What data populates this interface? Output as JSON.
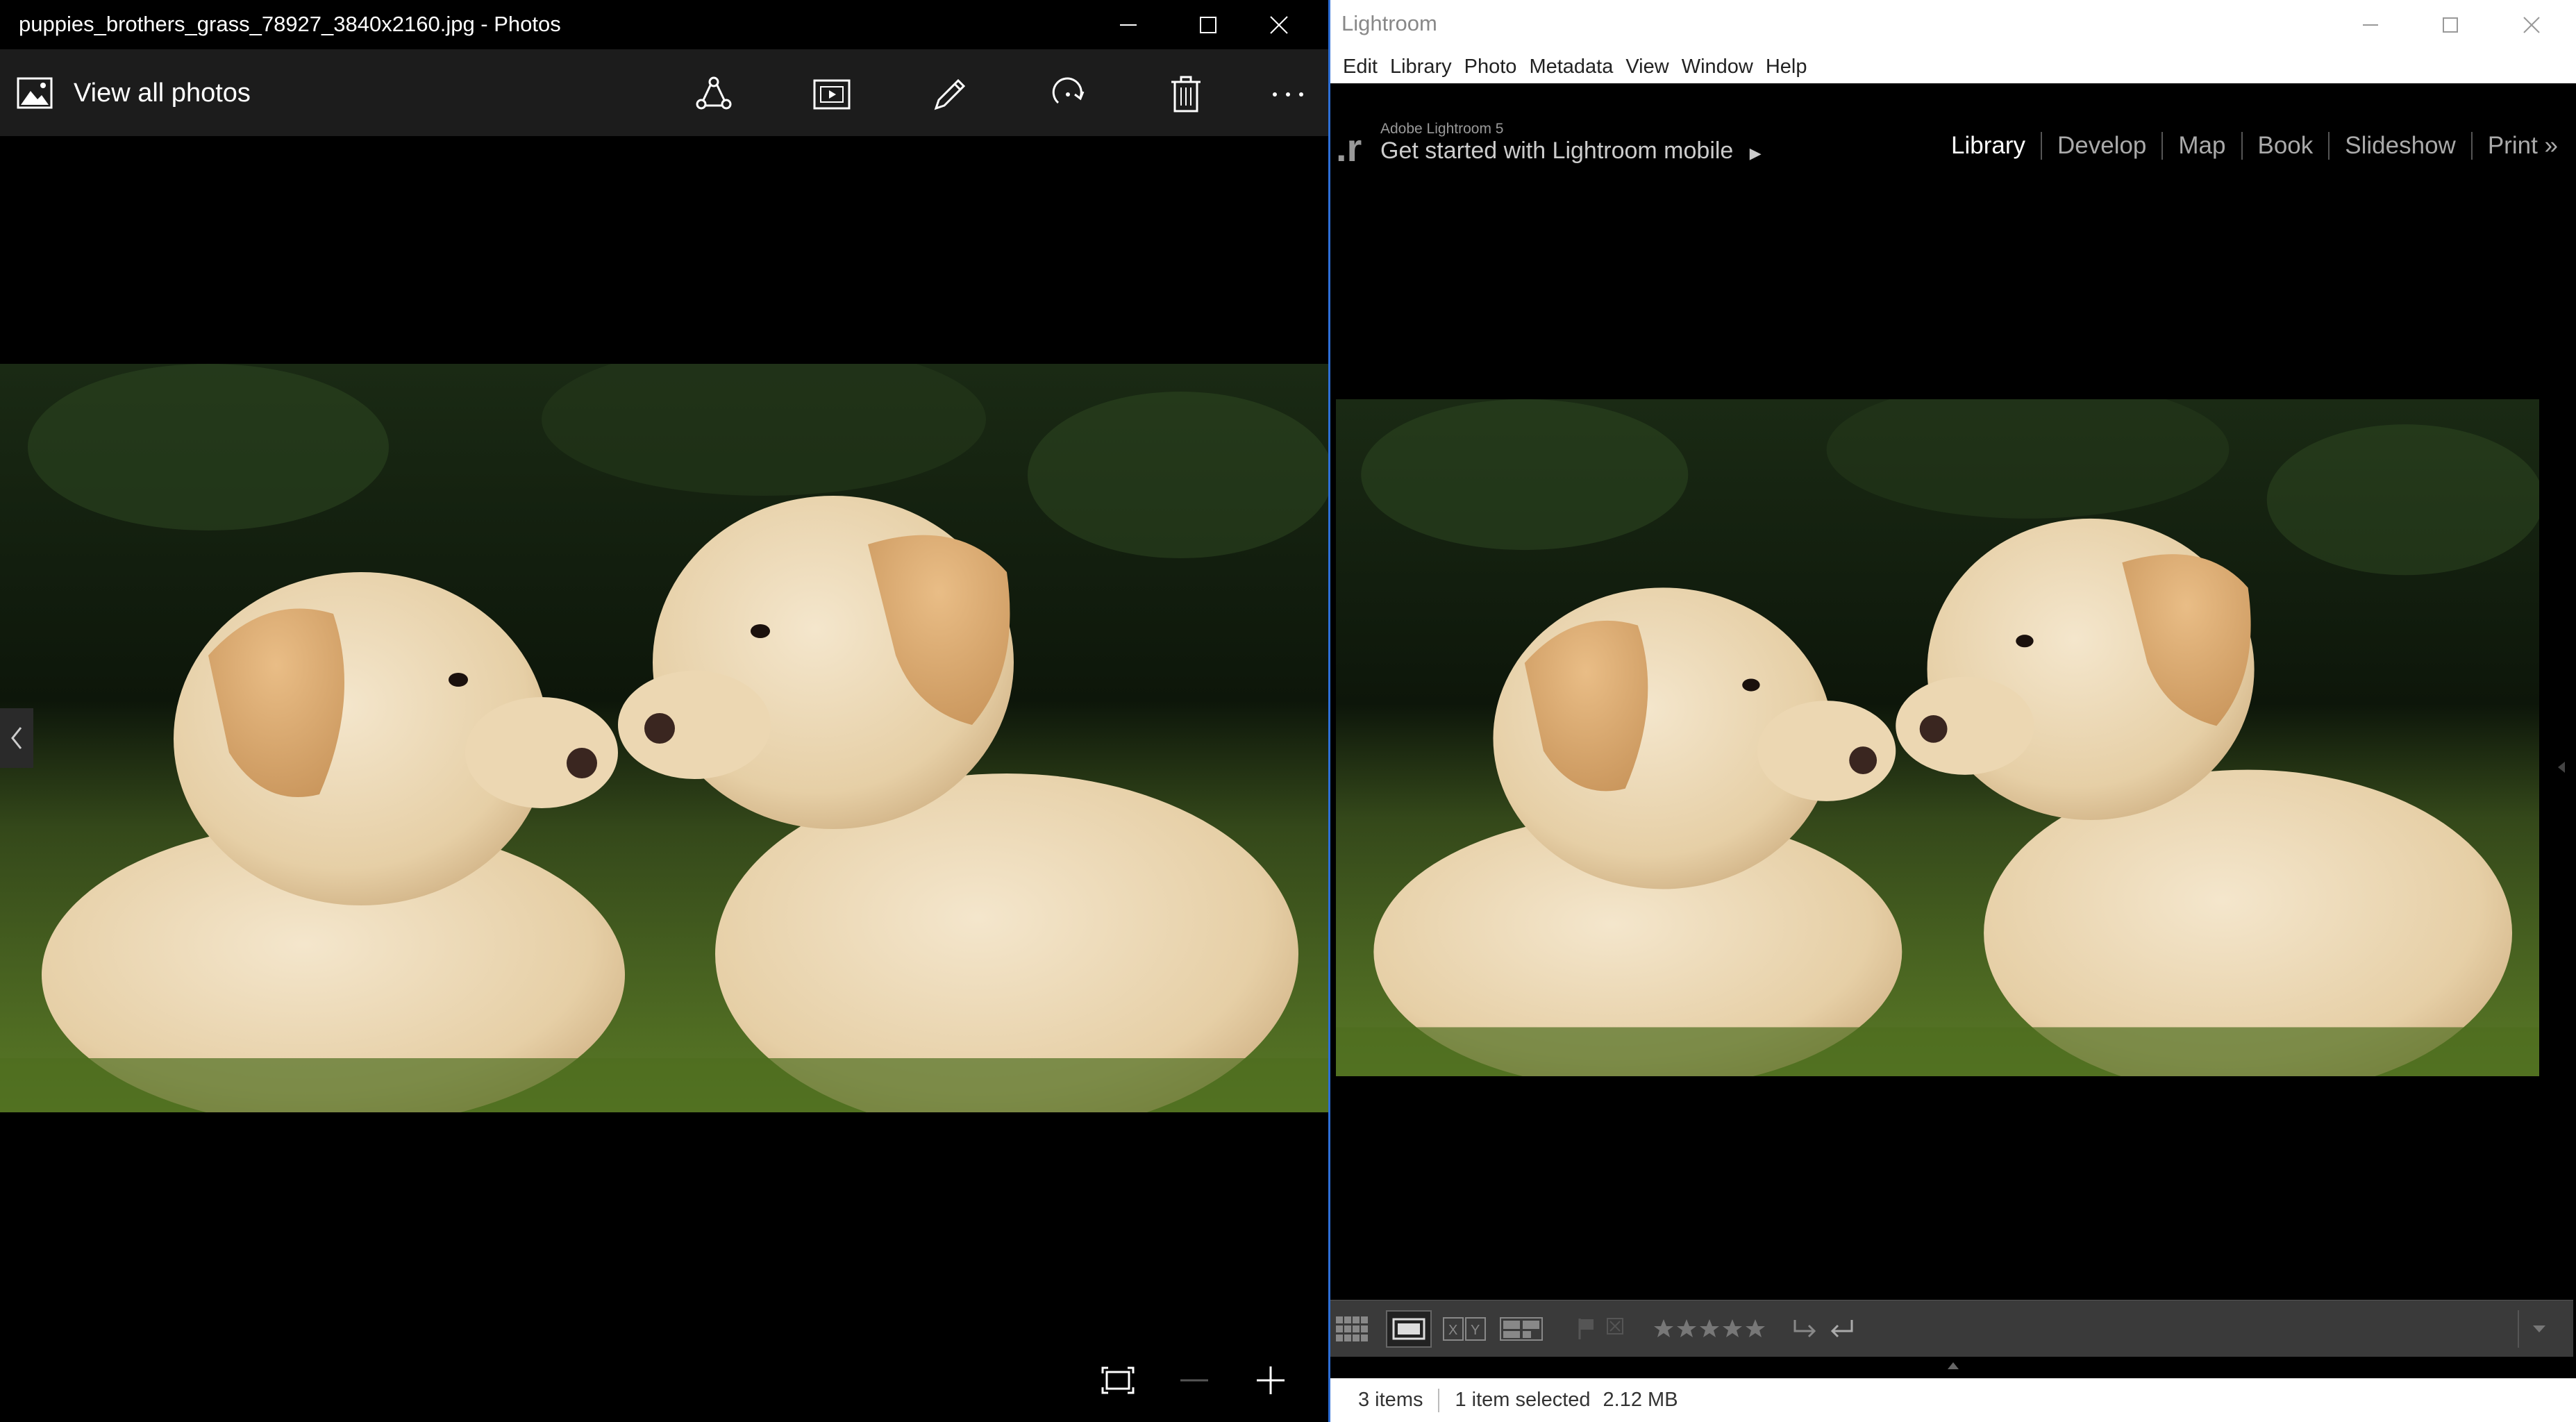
{
  "photos": {
    "window_title": "puppies_brothers_grass_78927_3840x2160.jpg - Photos",
    "view_all_label": "View all photos",
    "toolbar_icons": [
      "share-icon",
      "slideshow-icon",
      "edit-icon",
      "rotate-icon",
      "delete-icon",
      "more-icon"
    ],
    "zoom_icons": [
      "fit-icon",
      "zoom-out-icon",
      "zoom-in-icon"
    ]
  },
  "lightroom": {
    "window_title": "Lightroom",
    "menu": [
      "Edit",
      "Library",
      "Photo",
      "Metadata",
      "View",
      "Window",
      "Help"
    ],
    "identity_sub": "Adobe Lightroom 5",
    "identity_main": "Get started with Lightroom mobile",
    "modules": [
      "Library",
      "Develop",
      "Map",
      "Book",
      "Slideshow",
      "Print"
    ],
    "active_module": "Library",
    "status": {
      "items": "3 items",
      "selected": "1 item selected",
      "size": "2.12 MB"
    }
  },
  "colors": {
    "accent_border": "#2d6fd6",
    "photos_toolbar": "#1c1c1c",
    "lr_toolbar": "#3a3a3a"
  }
}
